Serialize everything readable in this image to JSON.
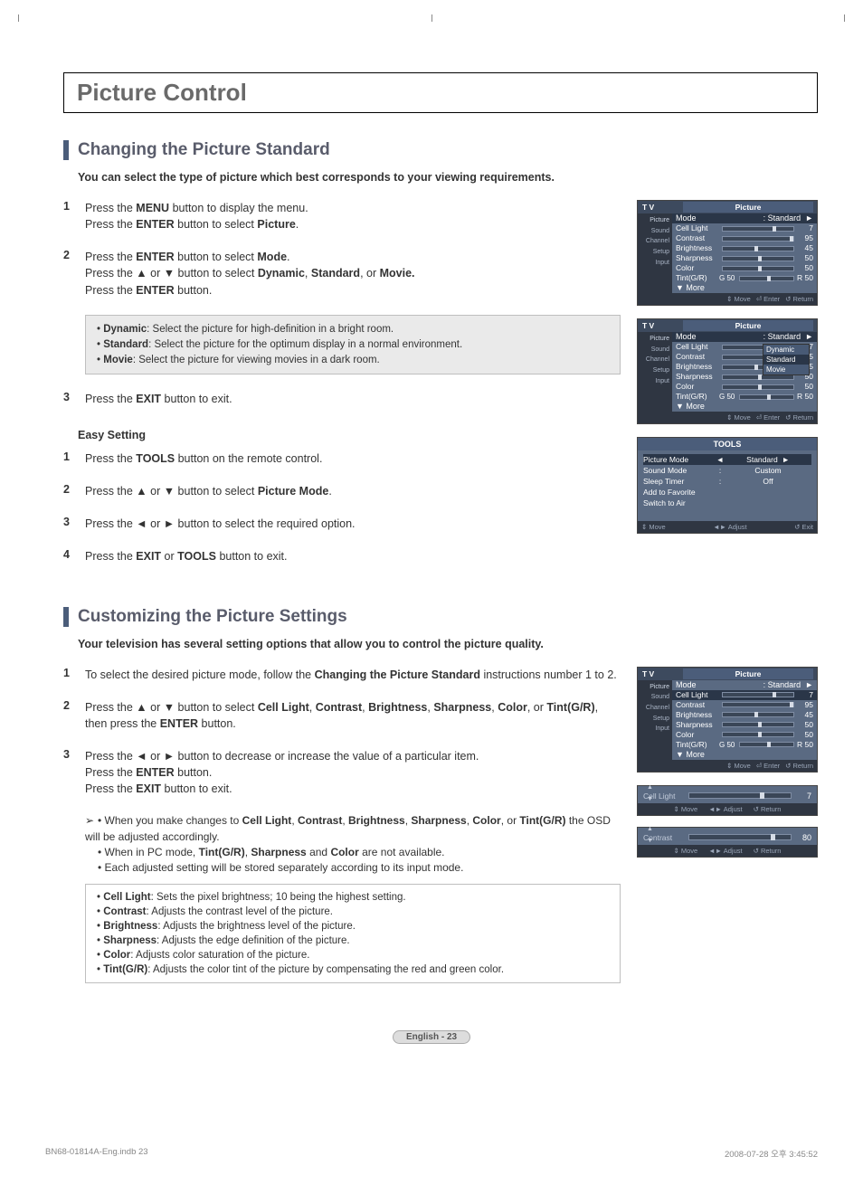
{
  "main_title": "Picture Control",
  "section1": {
    "heading": "Changing the Picture Standard",
    "intro": "You can select the type of picture which best corresponds to your viewing requirements.",
    "steps": [
      {
        "num": "1",
        "html": "Press the <b>MENU</b> button to display the menu.<br>Press the <b>ENTER</b> button to select <b>Picture</b>."
      },
      {
        "num": "2",
        "html": "Press the <b>ENTER</b> button to select <b>Mode</b>.<br>Press the ▲ or ▼ button to select <b>Dynamic</b>, <b>Standard</b>, or <b>Movie.</b><br>Press the <b>ENTER</b> button."
      },
      {
        "num": "3",
        "html": "Press the <b>EXIT</b> button to exit."
      }
    ],
    "info": [
      {
        "b": "Dynamic",
        "t": ": Select the picture for high-definition in a bright room."
      },
      {
        "b": "Standard",
        "t": ": Select the picture for the optimum display in a normal environment."
      },
      {
        "b": "Movie",
        "t": ": Select the picture for viewing movies in a dark room."
      }
    ],
    "easy_heading": "Easy Setting",
    "easy_steps": [
      {
        "num": "1",
        "html": "Press the <b>TOOLS</b> button on the remote control."
      },
      {
        "num": "2",
        "html": "Press the ▲ or ▼ button to select <b>Picture Mode</b>."
      },
      {
        "num": "3",
        "html": "Press the ◄ or ► button to select the required option."
      },
      {
        "num": "4",
        "html": "Press the <b>EXIT</b> or <b>TOOLS</b> button to exit."
      }
    ]
  },
  "section2": {
    "heading": "Customizing the Picture Settings",
    "intro": "Your television has several setting options that allow you to control the picture quality.",
    "steps": [
      {
        "num": "1",
        "html": "To select the desired picture mode, follow the <b>Changing the Picture Standard</b> instructions number 1 to 2."
      },
      {
        "num": "2",
        "html": "Press the ▲ or ▼ button to select <b>Cell Light</b>, <b>Contrast</b>, <b>Brightness</b>, <b>Sharpness</b>, <b>Color</b>, or <b>Tint(G/R)</b>, then press the <b>ENTER</b> button."
      },
      {
        "num": "3",
        "html": "Press the ◄ or ► button to decrease or increase the value of a particular item.<br>Press the <b>ENTER</b> button.<br>Press the <b>EXIT</b> button to exit."
      }
    ],
    "notes": [
      "When you make changes to <b>Cell Light</b>, <b>Contrast</b>, <b>Brightness</b>, <b>Sharpness</b>, <b>Color</b>, or <b>Tint(G/R)</b> the OSD will be adjusted accordingly.",
      "When in PC mode, <b>Tint(G/R)</b>, <b>Sharpness</b> and <b>Color</b> are not available.",
      "Each adjusted setting will be stored separately according to its input mode."
    ],
    "desc": [
      {
        "b": "Cell Light",
        "t": ": Sets the pixel brightness; 10 being the highest setting."
      },
      {
        "b": "Contrast",
        "t": ": Adjusts the contrast level of the picture."
      },
      {
        "b": "Brightness",
        "t": ": Adjusts the brightness level of the picture."
      },
      {
        "b": "Sharpness",
        "t": ": Adjusts the edge definition of the picture."
      },
      {
        "b": "Color",
        "t": ": Adjusts color saturation of the picture."
      },
      {
        "b": "Tint(G/R)",
        "t": ": Adjusts the color tint of the picture by compensating the red and green color."
      }
    ]
  },
  "osd": {
    "tv_label": "T V",
    "picture_label": "Picture",
    "sidebar": [
      "Picture",
      "Sound",
      "Channel",
      "Setup",
      "Input"
    ],
    "rows": [
      {
        "label": "Mode",
        "value": ": Standard",
        "type": "mode"
      },
      {
        "label": "Cell Light",
        "knob": 70,
        "val": "7"
      },
      {
        "label": "Contrast",
        "knob": 95,
        "val": "95"
      },
      {
        "label": "Brightness",
        "knob": 45,
        "val": "45"
      },
      {
        "label": "Sharpness",
        "knob": 50,
        "val": "50"
      },
      {
        "label": "Color",
        "knob": 50,
        "val": "50"
      },
      {
        "label": "Tint(G/R)",
        "pre": "G 50",
        "knob": 50,
        "val": "R 50"
      },
      {
        "label": "▼ More",
        "type": "more"
      }
    ],
    "footer": {
      "move": "Move",
      "enter": "Enter",
      "return": "Return"
    },
    "dropdown": [
      "Dynamic",
      "Standard",
      "Movie"
    ]
  },
  "tools": {
    "title": "TOOLS",
    "rows": [
      {
        "l": "Picture Mode",
        "c": "◄",
        "r": "Standard",
        "arrow": "►",
        "hl": true
      },
      {
        "l": "Sound Mode",
        "c": ":",
        "r": "Custom"
      },
      {
        "l": "Sleep Timer",
        "c": ":",
        "r": "Off"
      },
      {
        "l": "Add to Favorite"
      },
      {
        "l": "Switch to Air"
      }
    ],
    "footer": {
      "move": "Move",
      "adjust": "Adjust",
      "exit": "Exit"
    }
  },
  "slider1": {
    "label": "Cell Light",
    "knob": 70,
    "val": "7"
  },
  "slider2": {
    "label": "Contrast",
    "knob": 80,
    "val": "80"
  },
  "slider_footer": {
    "move": "Move",
    "adjust": "Adjust",
    "return": "Return"
  },
  "page_num": "English - 23",
  "print_left": "BN68-01814A-Eng.indb   23",
  "print_right": "2008-07-28   오후 3:45:52"
}
